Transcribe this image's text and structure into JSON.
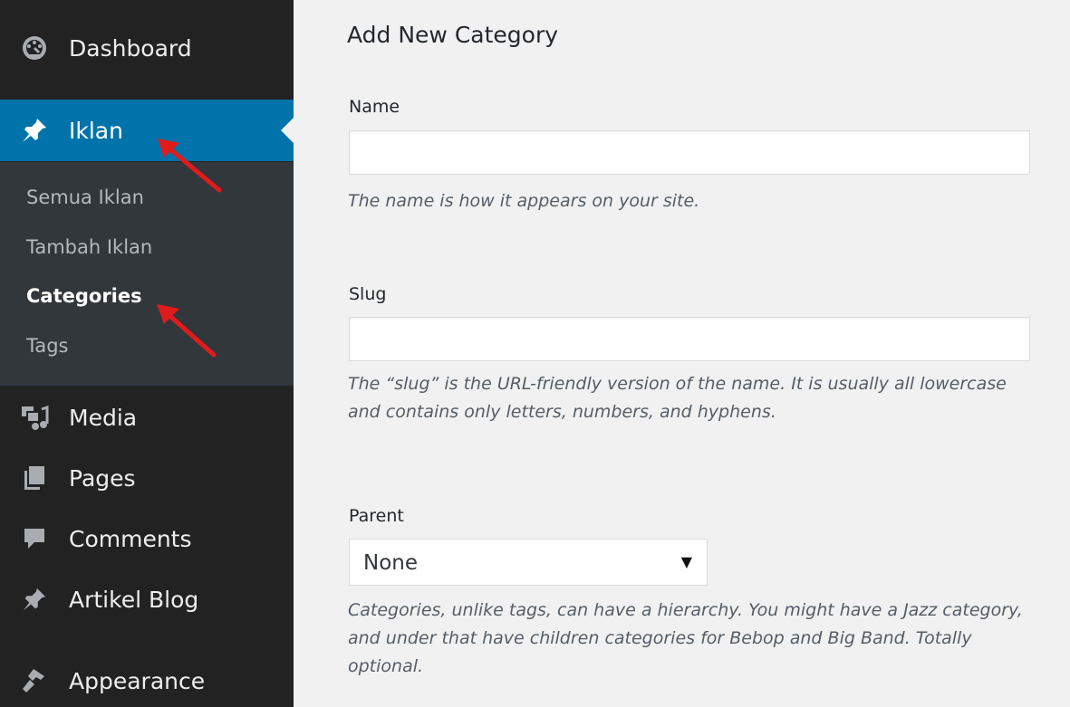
{
  "sidebar": {
    "items": [
      {
        "label": "Dashboard",
        "icon": "dashboard-icon"
      },
      {
        "label": "Iklan",
        "icon": "pushpin-icon"
      },
      {
        "label": "Media",
        "icon": "media-icon"
      },
      {
        "label": "Pages",
        "icon": "pages-icon"
      },
      {
        "label": "Comments",
        "icon": "comments-icon"
      },
      {
        "label": "Artikel Blog",
        "icon": "pushpin-icon"
      },
      {
        "label": "Appearance",
        "icon": "appearance-icon"
      }
    ],
    "submenu": [
      {
        "label": "Semua Iklan"
      },
      {
        "label": "Tambah Iklan"
      },
      {
        "label": "Categories"
      },
      {
        "label": "Tags"
      }
    ]
  },
  "form": {
    "title": "Add New Category",
    "name_label": "Name",
    "name_value": "",
    "name_help": "The name is how it appears on your site.",
    "slug_label": "Slug",
    "slug_value": "",
    "slug_help": "The “slug” is the URL-friendly version of the name. It is usually all lowercase and contains only letters, numbers, and hyphens.",
    "parent_label": "Parent",
    "parent_selected": "None",
    "parent_help": "Categories, unlike tags, can have a hierarchy. You might have a Jazz category, and under that have children categories for Bebop and Big Band. Totally optional."
  },
  "colors": {
    "sidebar_bg": "#222222",
    "submenu_bg": "#32373c",
    "active_bg": "#0073aa",
    "content_bg": "#f1f1f1",
    "annotation_arrow": "#e01b1b"
  }
}
